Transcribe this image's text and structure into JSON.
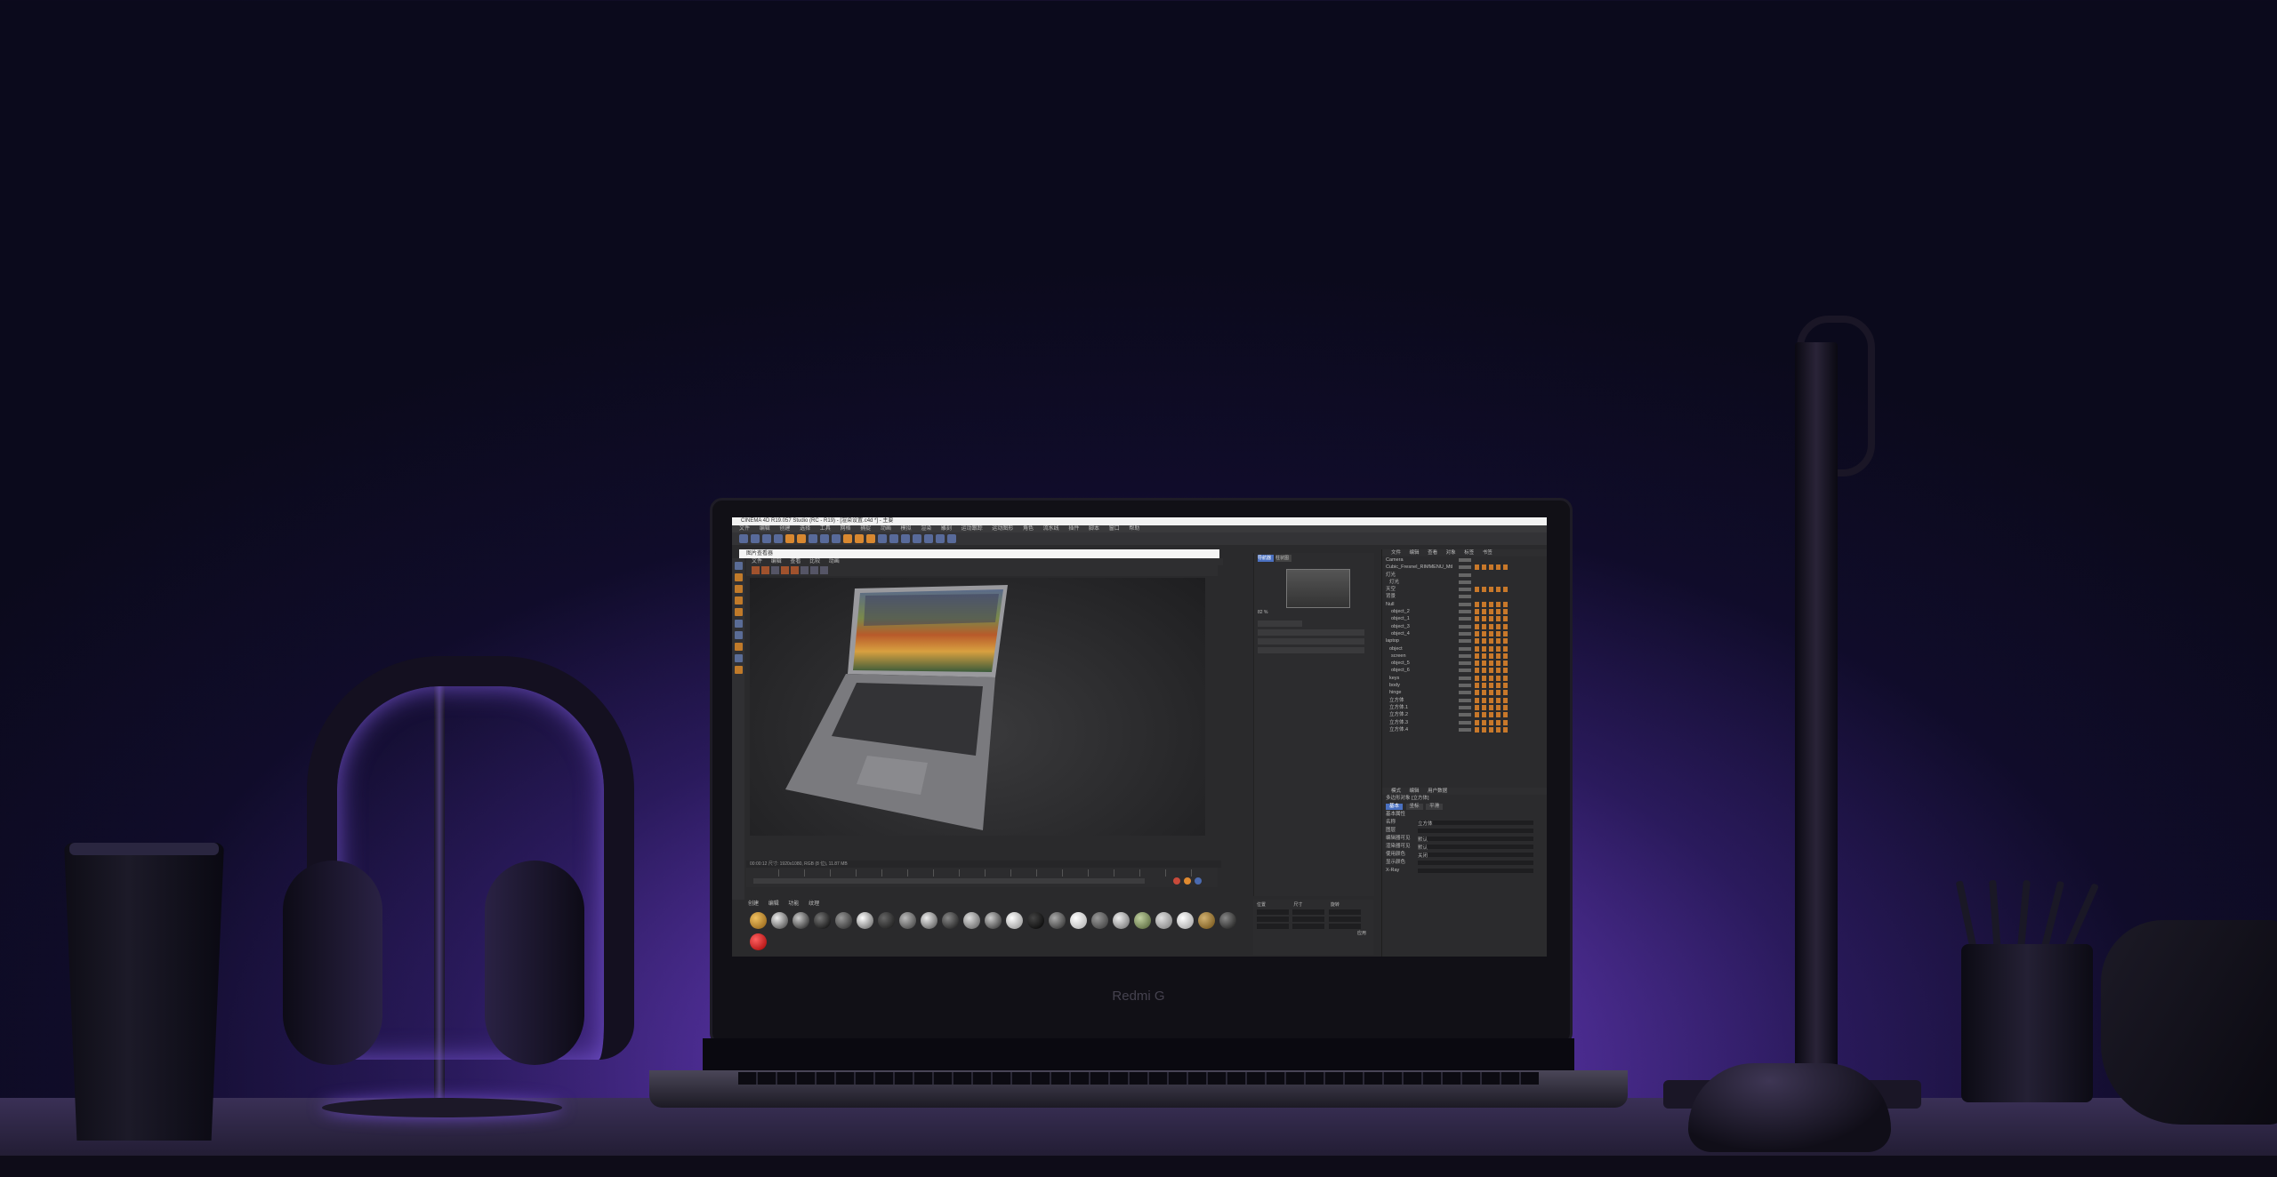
{
  "scene": {
    "brand_logo": "Redmi G",
    "accent": "#7a4ee0"
  },
  "app": {
    "window_title": "CINEMA 4D R19.057 Studio (RC - R19) - [渲染设置.c4d *] - 主要",
    "menu": [
      "文件",
      "编辑",
      "创建",
      "选择",
      "工具",
      "网格",
      "捕捉",
      "动画",
      "模拟",
      "渲染",
      "雕刻",
      "运动跟踪",
      "运动图形",
      "角色",
      "流水线",
      "插件",
      "脚本",
      "窗口",
      "帮助"
    ],
    "render_window_title": "图片查看器",
    "viewport_menu": [
      "文件",
      "编辑",
      "查看",
      "比较",
      "动画"
    ],
    "attr_tabs": [
      "导航器",
      "柱状图"
    ],
    "status_text": "00:00:12   尺寸: 1920x1080, RGB (8 位), 11.87 MB",
    "zoom_label": "82 %",
    "material_menu": [
      "创建",
      "编辑",
      "功能",
      "纹理"
    ],
    "coords_headers": [
      "位置",
      "尺寸",
      "旋转"
    ],
    "coords_values": [
      "0 cm",
      "0 cm",
      "0 cm"
    ],
    "apply_button": "应用",
    "object_manager_menu": [
      "文件",
      "编辑",
      "查看",
      "对象",
      "标签",
      "书签"
    ],
    "objects": [
      "Camera",
      "Cubic_Fresnel_RIMMENU_Mtl",
      "灯光",
      "灯光",
      "天空",
      "背景",
      "Null",
      "object_2",
      "object_1",
      "object_3",
      "object_4",
      "laptop",
      "object",
      "screen",
      "object_5",
      "object_6",
      "keys",
      "body",
      "hinge",
      "立方体",
      "立方体.1",
      "立方体.2",
      "立方体.3",
      "立方体.4"
    ],
    "attr_manager_menu": [
      "模式",
      "编辑",
      "用户数据"
    ],
    "attr_manager_title": "多边形对象 [立方体]",
    "attr_manager_tabs": [
      "基本",
      "坐标",
      "平滑"
    ],
    "attr_manager_section": "基本属性",
    "attr_manager_fields": [
      "名称",
      "图层",
      "编辑器可见",
      "渲染器可见",
      "使用颜色",
      "显示颜色",
      "X-Ray"
    ],
    "attr_manager_values": [
      "立方体",
      "",
      "默认",
      "默认",
      "关闭",
      "",
      ""
    ]
  }
}
